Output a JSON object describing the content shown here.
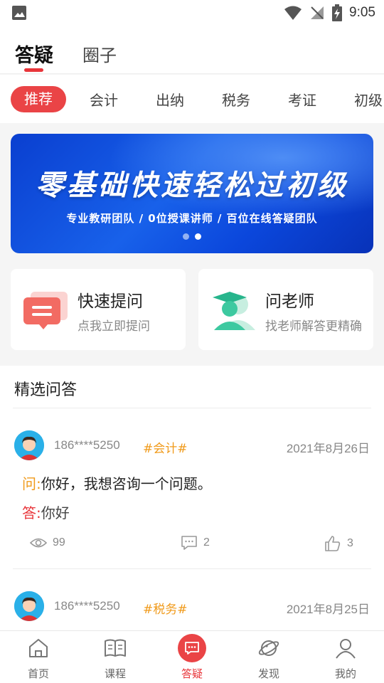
{
  "status_bar": {
    "time": "9:05"
  },
  "top_tabs": [
    {
      "label": "答疑",
      "active": true
    },
    {
      "label": "圈子",
      "active": false
    }
  ],
  "categories": [
    "推荐",
    "会计",
    "出纳",
    "税务",
    "考证",
    "初级"
  ],
  "banner": {
    "headline": "零基础快速轻松过初级",
    "subline": "专业教研团队 /  0位授课讲师  /  百位在线答疑团队",
    "slide_count": 2,
    "active_slide": 2
  },
  "quick_ask": {
    "title": "快速提问",
    "desc": "点我立即提问"
  },
  "ask_teacher": {
    "title": "问老师",
    "desc": "找老师解答更精确"
  },
  "featured": {
    "title": "精选问答",
    "question_label": "问:",
    "answer_label": "答:",
    "items": [
      {
        "user": "186****5250",
        "tag": "#会计#",
        "date": "2021年8月26日",
        "question": "你好，我想咨询一个问题。",
        "answer": "你好",
        "views": "99",
        "comments": "2",
        "likes": "3"
      },
      {
        "user": "186****5250",
        "tag": "#税务#",
        "date": "2021年8月25日"
      }
    ]
  },
  "bottom_nav": [
    {
      "label": "首页",
      "icon": "home-icon"
    },
    {
      "label": "课程",
      "icon": "book-icon"
    },
    {
      "label": "答疑",
      "icon": "chat-icon",
      "active": true
    },
    {
      "label": "发现",
      "icon": "planet-icon"
    },
    {
      "label": "我的",
      "icon": "user-icon"
    }
  ],
  "colors": {
    "accent": "#e8353a",
    "tag": "#f09a1a",
    "banner": "#1861ea"
  }
}
